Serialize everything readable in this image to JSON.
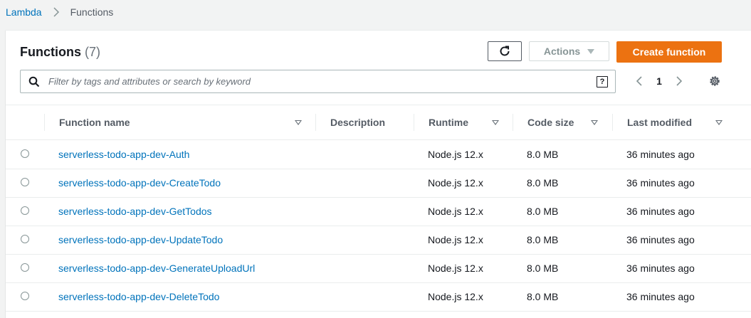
{
  "breadcrumb": {
    "root": "Lambda",
    "current": "Functions"
  },
  "header": {
    "title": "Functions",
    "count": "(7)"
  },
  "toolbar": {
    "actions_label": "Actions",
    "create_label": "Create function",
    "refresh_icon": "refresh-icon"
  },
  "search": {
    "placeholder": "Filter by tags and attributes or search by keyword",
    "value": "",
    "help": "?"
  },
  "pagination": {
    "current_page": "1"
  },
  "columns": {
    "name": "Function name",
    "description": "Description",
    "runtime": "Runtime",
    "code_size": "Code size",
    "last_modified": "Last modified"
  },
  "rows": [
    {
      "name": "serverless-todo-app-dev-Auth",
      "description": "",
      "runtime": "Node.js 12.x",
      "code_size": "8.0 MB",
      "last_modified": "36 minutes ago"
    },
    {
      "name": "serverless-todo-app-dev-CreateTodo",
      "description": "",
      "runtime": "Node.js 12.x",
      "code_size": "8.0 MB",
      "last_modified": "36 minutes ago"
    },
    {
      "name": "serverless-todo-app-dev-GetTodos",
      "description": "",
      "runtime": "Node.js 12.x",
      "code_size": "8.0 MB",
      "last_modified": "36 minutes ago"
    },
    {
      "name": "serverless-todo-app-dev-UpdateTodo",
      "description": "",
      "runtime": "Node.js 12.x",
      "code_size": "8.0 MB",
      "last_modified": "36 minutes ago"
    },
    {
      "name": "serverless-todo-app-dev-GenerateUploadUrl",
      "description": "",
      "runtime": "Node.js 12.x",
      "code_size": "8.0 MB",
      "last_modified": "36 minutes ago"
    },
    {
      "name": "serverless-todo-app-dev-DeleteTodo",
      "description": "",
      "runtime": "Node.js 12.x",
      "code_size": "8.0 MB",
      "last_modified": "36 minutes ago"
    }
  ],
  "colors": {
    "link": "#0073bb",
    "primary": "#ec7211",
    "border": "#eaeded",
    "text": "#16191f"
  }
}
